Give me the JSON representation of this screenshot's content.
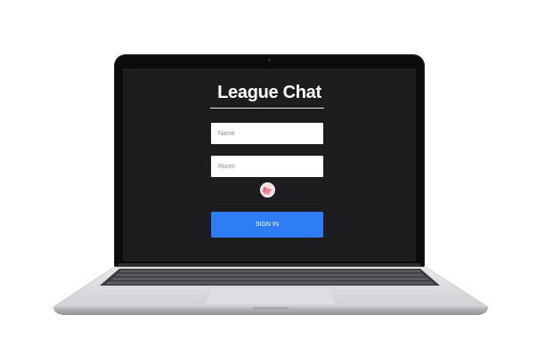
{
  "app": {
    "title": "League Chat",
    "name_placeholder": "Name",
    "room_placeholder": "Room",
    "signin_label": "SIGN IN",
    "avatar_icon": "pig-avatar-icon"
  },
  "colors": {
    "screen_bg": "#1d1d20",
    "button": "#2f7df4",
    "field_bg": "#ffffff",
    "title": "#ffffff"
  }
}
